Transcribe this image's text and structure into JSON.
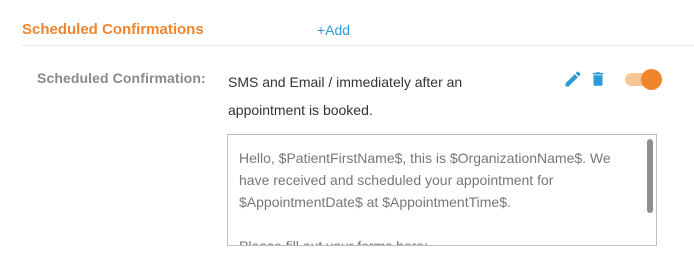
{
  "section": {
    "title": "Scheduled Confirmations",
    "add_label": "+Add"
  },
  "confirmation": {
    "label": "Scheduled Confirmation:",
    "description": "SMS and Email / immediately after an appointment is booked.",
    "enabled": true,
    "message": "Hello, $PatientFirstName$, this is $OrganizationName$. We have received and scheduled your appointment for $AppointmentDate$ at $AppointmentTime$.\n\nPlease fill out your forms here:"
  },
  "icons": {
    "edit": "pencil-icon",
    "delete": "trash-icon"
  },
  "colors": {
    "accent_orange": "#f0852d",
    "toggle_track": "#f8c595",
    "link_blue": "#2d9bd6",
    "label_gray": "#8a8a8a"
  }
}
